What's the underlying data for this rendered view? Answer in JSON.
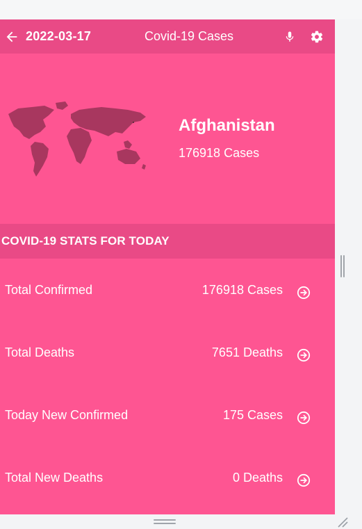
{
  "header": {
    "date": "2022-03-17",
    "title": "Covid-19 Cases"
  },
  "hero": {
    "country": "Afghanistan",
    "cases": "176918 Cases"
  },
  "section": {
    "title": "COVID-19 STATS FOR TODAY"
  },
  "stats": [
    {
      "label": "Total Confirmed",
      "value": "176918 Cases"
    },
    {
      "label": "Total Deaths",
      "value": "7651 Deaths"
    },
    {
      "label": "Today New Confirmed",
      "value": "175 Cases"
    },
    {
      "label": "Total New Deaths",
      "value": "0 Deaths"
    }
  ],
  "colors": {
    "background": "#fe5592",
    "appbar": "#e94a86",
    "map": "#a8375f"
  },
  "icons": [
    "arrow-back-icon",
    "mic-icon",
    "settings-icon",
    "world-map-icon",
    "arrow-circle-right-icon"
  ]
}
